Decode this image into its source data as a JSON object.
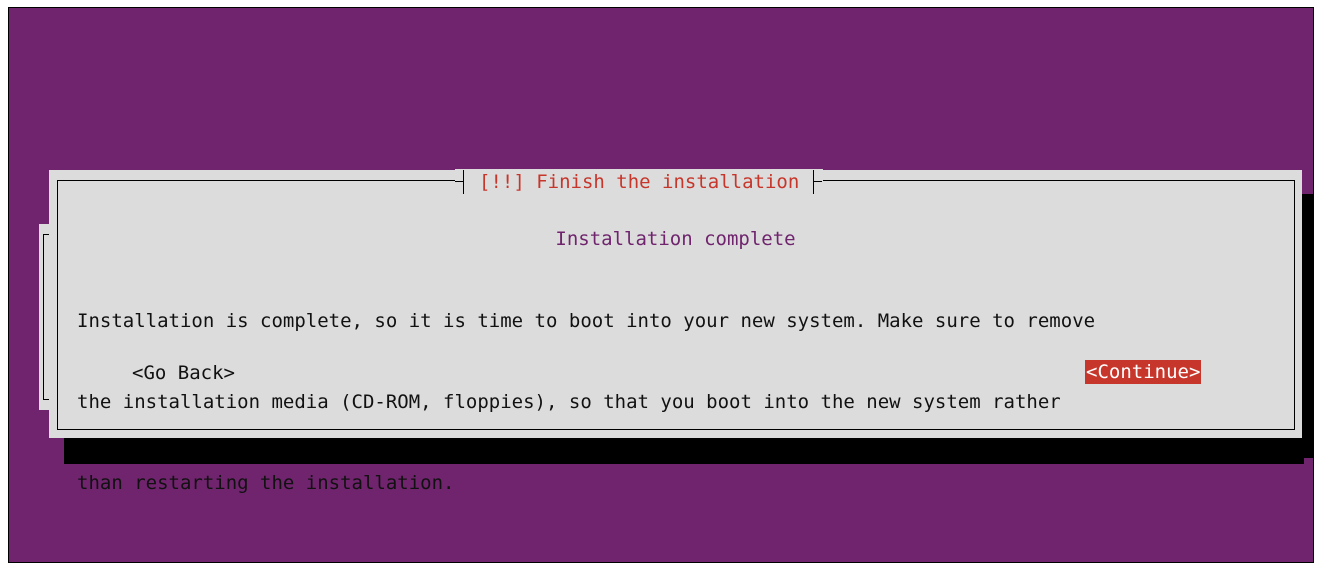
{
  "dialog": {
    "title": "[!!] Finish the installation",
    "subtitle": "Installation complete",
    "body_lines": [
      "Installation is complete, so it is time to boot into your new system. Make sure to remove",
      "the installation media (CD-ROM, floppies), so that you boot into the new system rather",
      "than restarting the installation."
    ],
    "buttons": {
      "back_label": "<Go Back>",
      "continue_label": "<Continue>"
    }
  },
  "colors": {
    "background": "#6f246d",
    "dialog": "#dcdcdc",
    "title_text": "#c7362b",
    "subtitle_text": "#6f246d",
    "selected_button": "#c7362b"
  }
}
